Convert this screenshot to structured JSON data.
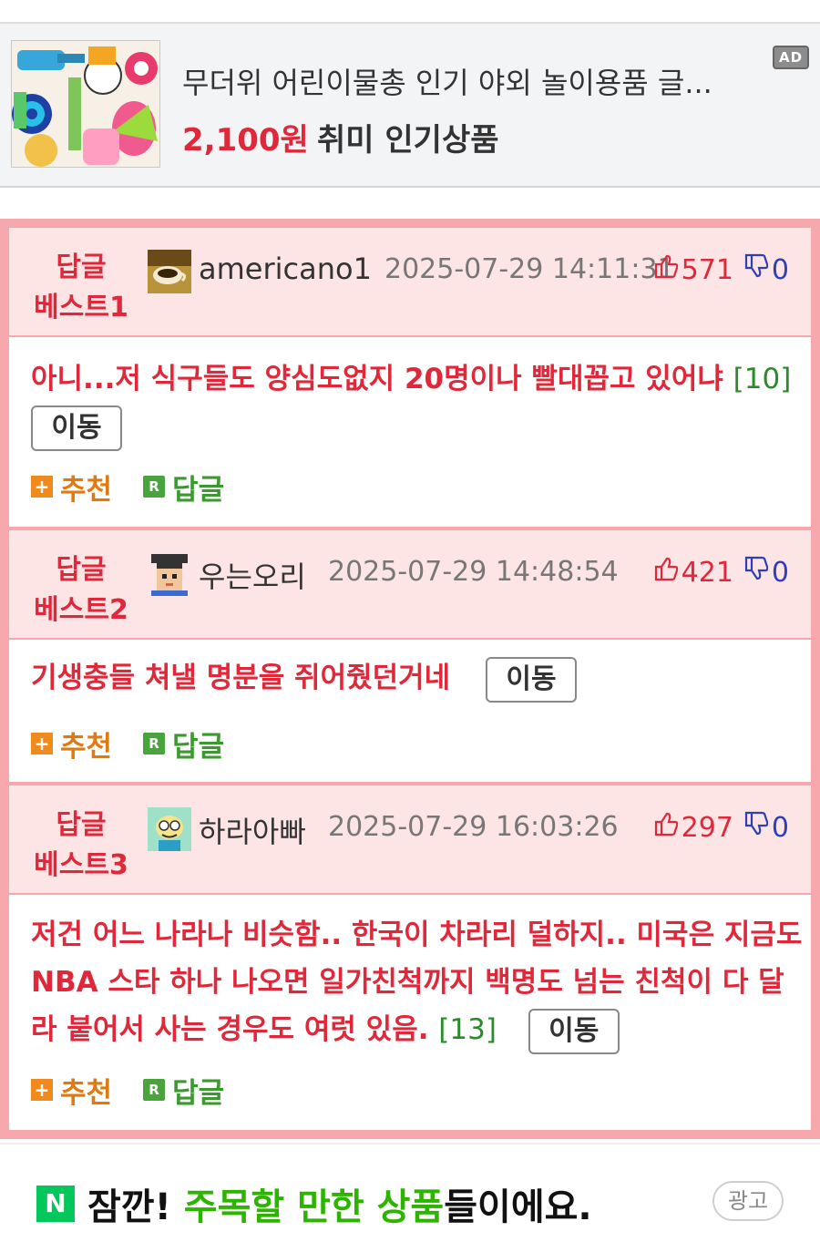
{
  "ad": {
    "title": "무더위 어린이물총 인기 야외 놀이용품 글...",
    "price": "2,100원",
    "category": "취미 인기상품",
    "tag": "AD"
  },
  "replies": [
    {
      "badge_line1": "답글",
      "badge_line2": "베스트1",
      "nickname": "americano1",
      "avatar": "coffee-cup-avatar",
      "datetime": "2025-07-29 14:11:31",
      "up": "571",
      "down": "0",
      "text": "아니...저 식구들도 양심도없지 20명이나 빨대꼽고 있어냐",
      "reply_count": "[10]",
      "move": "이동",
      "recommend": "추천",
      "reply": "답글"
    },
    {
      "badge_line1": "답글",
      "badge_line2": "베스트2",
      "nickname": "우는오리",
      "avatar": "pixel-person-avatar",
      "datetime": "2025-07-29 14:48:54",
      "up": "421",
      "down": "0",
      "text": "기생충들 쳐낼 명분을 쥐어줬던거네",
      "reply_count": "",
      "move": "이동",
      "recommend": "추천",
      "reply": "답글"
    },
    {
      "badge_line1": "답글",
      "badge_line2": "베스트3",
      "nickname": "하라아빠",
      "avatar": "cartoon-face-avatar",
      "datetime": "2025-07-29 16:03:26",
      "up": "297",
      "down": "0",
      "text": "저건 어느 나라나 비슷함.. 한국이 차라리 덜하지.. 미국은 지금도 NBA 스타 하나 나오면 일가친척까지 백명도 넘는 친척이 다 달라 붙어서 사는 경우도 여럿 있음.",
      "reply_count": "[13]",
      "move": "이동",
      "recommend": "추천",
      "reply": "답글"
    }
  ],
  "bottom": {
    "logo": "N",
    "text_prefix": "잠깐! ",
    "text_highlight": "주목할 만한 상품",
    "text_suffix": "들이에요.",
    "ad_label": "광고"
  },
  "colors": {
    "accent_red": "#e0283a",
    "down_blue": "#2f3fb6",
    "green": "#2c8a2c",
    "header_pink": "#fde5e6",
    "border_pink": "#f7a8ad",
    "naver_green": "#03c75a"
  }
}
